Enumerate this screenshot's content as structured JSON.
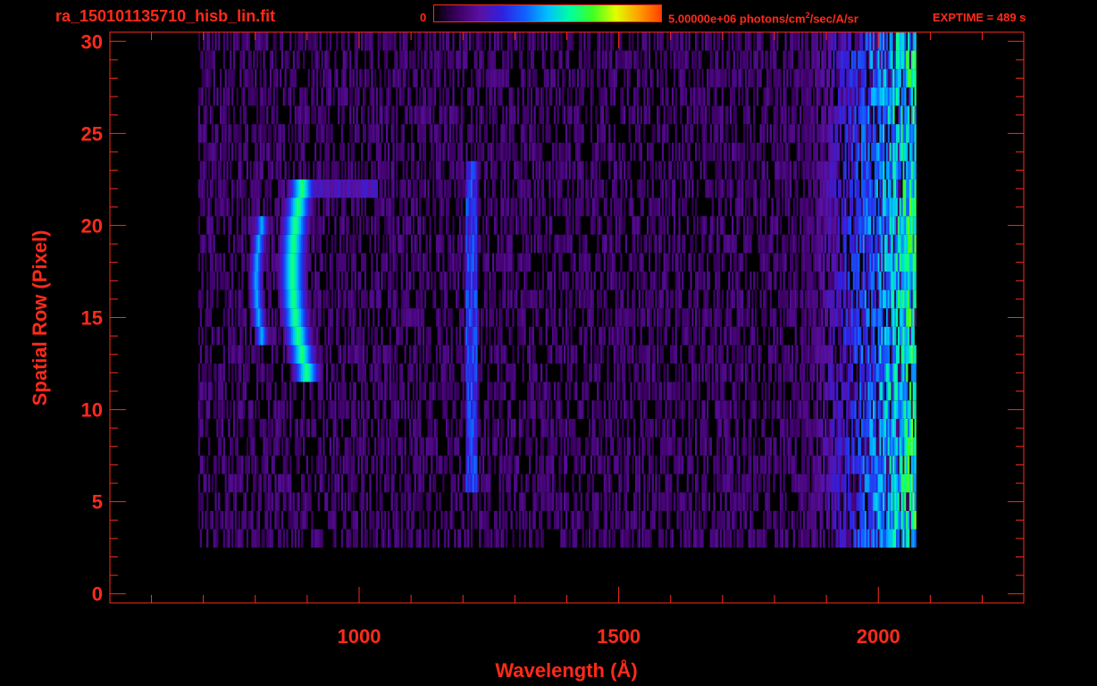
{
  "header": {
    "filename": "ra_150101135710_hisb_lin.fit",
    "colorbar_min": "0",
    "colorbar_max_prefix": "5.00000e+06 photons/cm",
    "colorbar_max_sup": "2",
    "colorbar_max_suffix": "/sec/A/sr",
    "exptime": "EXPTIME = 489 s"
  },
  "colors": {
    "axis": "#ff2a1a",
    "background": "#000000",
    "colormap": [
      "#000000",
      "#3a0060",
      "#5a10a0",
      "#3020e0",
      "#1060ff",
      "#00c0ff",
      "#00ffa0",
      "#40ff20",
      "#e0ff00",
      "#ffa000",
      "#ff4000"
    ]
  },
  "chart_data": {
    "type": "heatmap",
    "title": "ra_150101135710_hisb_lin.fit",
    "xlabel": "Wavelength (Å)",
    "ylabel": "Spatial Row (Pixel)",
    "xlim": [
      520,
      2280
    ],
    "ylim": [
      -0.5,
      30.5
    ],
    "x_ticks": [
      1000,
      1500,
      2000
    ],
    "x_tick_labels": [
      "1000",
      "1500",
      "2000"
    ],
    "y_ticks": [
      0,
      5,
      10,
      15,
      20,
      25,
      30
    ],
    "y_tick_labels": [
      "0",
      "5",
      "10",
      "15",
      "20",
      "25",
      "30"
    ],
    "color_range": [
      0,
      5000000
    ],
    "color_unit": "photons/cm^2/sec/A/sr",
    "data_x_range": [
      690,
      2070
    ],
    "data_rows": [
      3,
      30
    ],
    "features": [
      {
        "name": "arc-emission",
        "center_x_mid": 870,
        "row_range": [
          12,
          22
        ],
        "peak_level": 0.6
      },
      {
        "name": "inner-arc",
        "center_x_mid": 800,
        "row_range": [
          14,
          20
        ],
        "peak_level": 0.45
      },
      {
        "name": "arc-cap",
        "x_range": [
          930,
          1035
        ],
        "row": 22,
        "peak_level": 0.25
      },
      {
        "name": "line-1216",
        "x": 1215,
        "row_range": [
          6,
          23
        ],
        "peak_level": 0.35
      },
      {
        "name": "red-edge-noise",
        "x_range": [
          1850,
          2070
        ],
        "row_range": [
          2,
          30
        ],
        "peak_level": 0.6
      }
    ]
  }
}
